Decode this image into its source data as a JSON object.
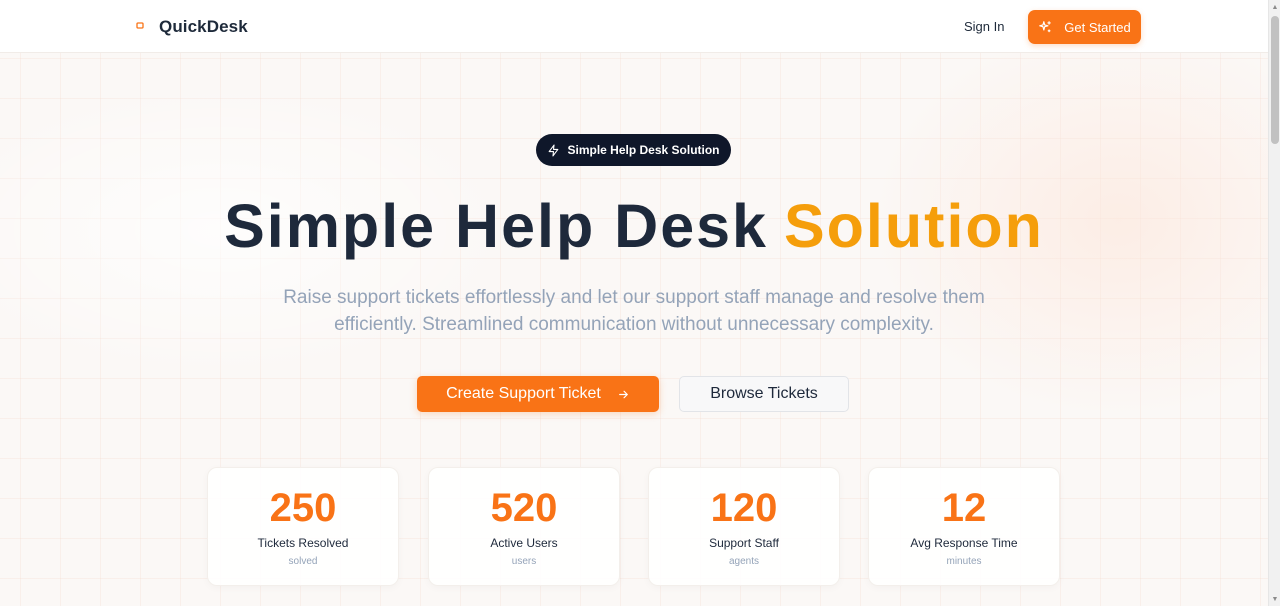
{
  "header": {
    "brand": "QuickDesk",
    "sign_in": "Sign In",
    "get_started": "Get Started"
  },
  "hero": {
    "badge": "Simple Help Desk Solution",
    "title_main": "Simple Help Desk",
    "title_accent": "Solution",
    "subtitle": "Raise support tickets effortlessly and let our support staff manage and resolve them efficiently. Streamlined communication without unnecessary complexity.",
    "primary_button": "Create Support Ticket",
    "secondary_button": "Browse Tickets"
  },
  "stats": [
    {
      "value": "250",
      "label": "Tickets Resolved",
      "unit": "solved"
    },
    {
      "value": "520",
      "label": "Active Users",
      "unit": "users"
    },
    {
      "value": "120",
      "label": "Support Staff",
      "unit": "agents"
    },
    {
      "value": "12",
      "label": "Avg Response Time",
      "unit": "minutes"
    }
  ],
  "colors": {
    "accent": "#f97316",
    "title_accent": "#f59e0b",
    "dark": "#1e293b",
    "muted": "#94a3b8"
  },
  "icons": {
    "logo": "ticket-icon",
    "get_started": "sparkles-icon",
    "badge": "lightning-icon",
    "primary_button": "arrow-right-icon"
  }
}
